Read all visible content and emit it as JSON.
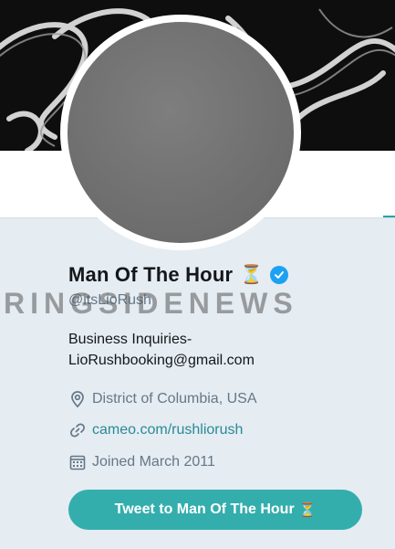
{
  "profile": {
    "display_name": "Man Of The Hour",
    "name_emoji": "⏳",
    "handle": "@itsLioRush",
    "bio_line1": "Business Inquiries-",
    "bio_line2": "LioRushbooking@gmail.com",
    "location": "District of Columbia, USA",
    "website": "cameo.com/rushliorush",
    "joined": "Joined March 2011"
  },
  "watermark": "RINGSIDENEWS",
  "tweet_button": {
    "label": "Tweet to Man Of The Hour",
    "emoji": "⏳"
  },
  "colors": {
    "accent": "#33aead",
    "link": "#2a8a95",
    "verified": "#1da1f2",
    "panel_bg": "#e5ecf2"
  },
  "icons": [
    "location-pin-icon",
    "link-icon",
    "calendar-icon",
    "verified-badge-icon",
    "hourglass-icon"
  ]
}
